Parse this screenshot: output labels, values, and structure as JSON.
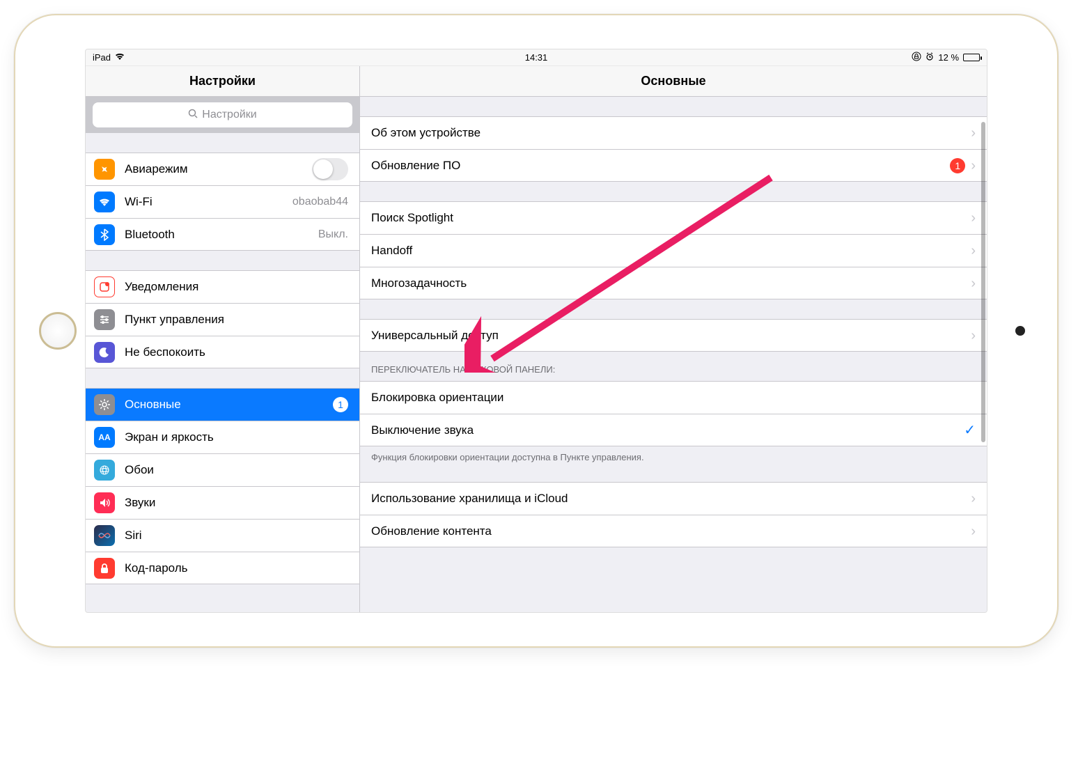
{
  "status": {
    "carrier": "iPad",
    "time": "14:31",
    "battery_text": "12 %"
  },
  "sidebar": {
    "title": "Настройки",
    "search_placeholder": "Настройки",
    "group1": [
      {
        "label": "Авиарежим",
        "icon": "airplane",
        "color": "#ff9500",
        "toggle": false
      },
      {
        "label": "Wi-Fi",
        "icon": "wifi",
        "color": "#007aff",
        "value": "obaobab44"
      },
      {
        "label": "Bluetooth",
        "icon": "bluetooth",
        "color": "#007aff",
        "value": "Выкл."
      }
    ],
    "group2": [
      {
        "label": "Уведомления",
        "icon": "notifications",
        "color": "#ff3b30"
      },
      {
        "label": "Пункт управления",
        "icon": "controls",
        "color": "#8e8e93"
      },
      {
        "label": "Не беспокоить",
        "icon": "dnd",
        "color": "#5856d6"
      }
    ],
    "group3": [
      {
        "label": "Основные",
        "icon": "gear",
        "color": "#8e8e93",
        "selected": true,
        "badge": "1"
      },
      {
        "label": "Экран и яркость",
        "icon": "display",
        "color": "#007aff"
      },
      {
        "label": "Обои",
        "icon": "wallpaper",
        "color": "#34aadc"
      },
      {
        "label": "Звуки",
        "icon": "sounds",
        "color": "#ff2d55"
      },
      {
        "label": "Siri",
        "icon": "siri",
        "color": "#444"
      },
      {
        "label": "Код-пароль",
        "icon": "passcode",
        "color": "#ff3b30"
      }
    ]
  },
  "detail": {
    "title": "Основные",
    "g1": [
      {
        "label": "Об этом устройстве"
      },
      {
        "label": "Обновление ПО",
        "badge": "1"
      }
    ],
    "g2": [
      {
        "label": "Поиск Spotlight"
      },
      {
        "label": "Handoff"
      },
      {
        "label": "Многозадачность"
      }
    ],
    "g3": [
      {
        "label": "Универсальный доступ"
      }
    ],
    "side_switch": {
      "header": "Переключатель на боковой панели:",
      "opt1": "Блокировка ориентации",
      "opt2": "Выключение звука",
      "footer": "Функция блокировки ориентации доступна в Пункте управления."
    },
    "g5": [
      {
        "label": "Использование хранилища и iCloud"
      },
      {
        "label": "Обновление контента"
      }
    ]
  }
}
